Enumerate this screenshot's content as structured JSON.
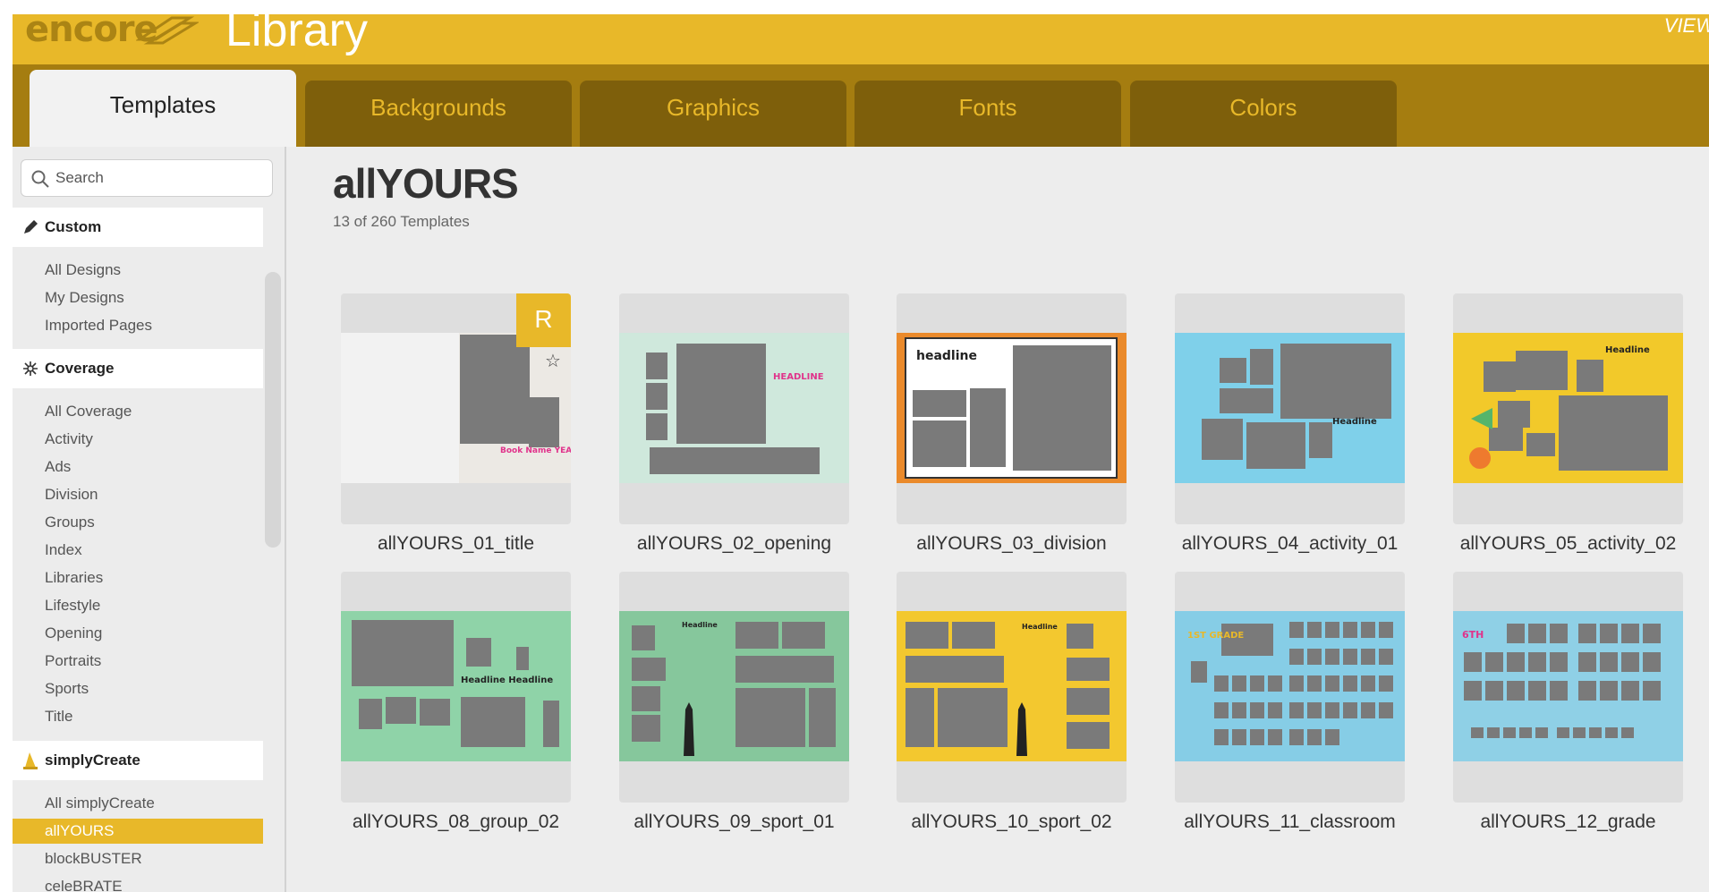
{
  "header": {
    "brand": "encore",
    "title": "Library",
    "view_link": "VIEW"
  },
  "tabs": [
    {
      "label": "Templates",
      "active": true
    },
    {
      "label": "Backgrounds",
      "active": false
    },
    {
      "label": "Graphics",
      "active": false
    },
    {
      "label": "Fonts",
      "active": false
    },
    {
      "label": "Colors",
      "active": false
    }
  ],
  "sidebar": {
    "search_placeholder": "Search",
    "sections": [
      {
        "label": "Custom",
        "icon": "pencil-icon",
        "items": [
          "All Designs",
          "My Designs",
          "Imported Pages"
        ]
      },
      {
        "label": "Coverage",
        "icon": "sparkle-icon",
        "items": [
          "All Coverage",
          "Activity",
          "Ads",
          "Division",
          "Groups",
          "Index",
          "Libraries",
          "Lifestyle",
          "Opening",
          "Portraits",
          "Sports",
          "Title"
        ]
      },
      {
        "label": "simplyCreate",
        "icon": "wizard-hat-icon",
        "items": [
          "All simplyCreate",
          "allYOURS",
          "blockBUSTER",
          "celeBRATE"
        ],
        "selected": "allYOURS"
      }
    ]
  },
  "main": {
    "title": "allYOURS",
    "count": "13 of 260 Templates",
    "badge": "R",
    "templates": [
      {
        "name": "allYOURS_01_title",
        "bg": "#f2f2f2",
        "headline": "Book Name YEAR"
      },
      {
        "name": "allYOURS_02_opening",
        "bg": "#cfe8dc",
        "headline": "HEADLINE"
      },
      {
        "name": "allYOURS_03_division",
        "bg": "#ea8a2b",
        "headline": "headline"
      },
      {
        "name": "allYOURS_04_activity_01",
        "bg": "#7fd0ea",
        "headline": "Headline"
      },
      {
        "name": "allYOURS_05_activity_02",
        "bg": "#f2c92a",
        "headline": "Headline"
      },
      {
        "name": "allYOURS_08_group_02",
        "bg": "#8fd3a8",
        "headline": "Headline Headline"
      },
      {
        "name": "allYOURS_09_sport_01",
        "bg": "#86c79c",
        "headline": "Headline"
      },
      {
        "name": "allYOURS_10_sport_02",
        "bg": "#f3c82f",
        "headline": "Headline"
      },
      {
        "name": "allYOURS_11_classroom",
        "bg": "#86cde6",
        "headline": "1ST GRADE"
      },
      {
        "name": "allYOURS_12_grade",
        "bg": "#8fd0e6",
        "headline": "6TH"
      }
    ]
  },
  "colors": {
    "header": "#e8b829",
    "tabbar": "#a57d10",
    "tab": "#7e5f0b",
    "accent": "#e8b829",
    "placeholder": "#7a7a7a"
  }
}
